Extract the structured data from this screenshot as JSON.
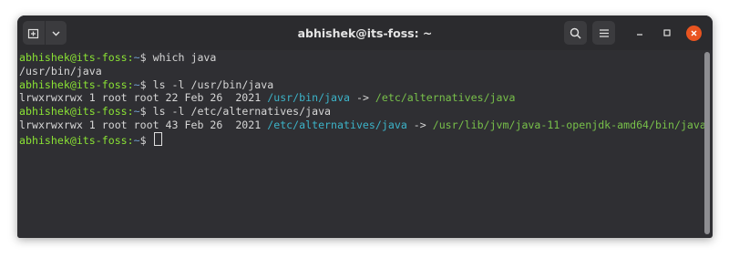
{
  "window": {
    "title": "abhishek@its-foss: ~",
    "controls": [
      "new-tab-icon",
      "chevron-down-icon",
      "search-icon",
      "hamburger-menu-icon",
      "minimize-icon",
      "maximize-icon",
      "close-icon"
    ],
    "close_color": "#e95420"
  },
  "terminal": {
    "prompt_user": "abhishek@its-foss:",
    "prompt_path": "~",
    "prompt_symbol": "$ ",
    "lines": [
      {
        "cmd": "which java"
      },
      {
        "out": "/usr/bin/java"
      },
      {
        "cmd": "ls -l /usr/bin/java"
      },
      {
        "perms": "lrwxrwxrwx 1 root root 22 Feb 26  2021 ",
        "link": "/usr/bin/java",
        "arrow": " -> ",
        "target": "/etc/alternatives/java"
      },
      {
        "cmd": "ls -l /etc/alternatives/java"
      },
      {
        "perms": "lrwxrwxrwx 1 root root 43 Feb 26  2021 ",
        "link": "/etc/alternatives/java",
        "arrow": " -> ",
        "target": "/usr/lib/jvm/java-11-openjdk-amd64/bin/java"
      }
    ]
  },
  "colors": {
    "prompt_user": "#8ae234",
    "prompt_path": "#729fcf",
    "symlink": "#3cb3c8",
    "symlink_target": "#78c04a"
  }
}
